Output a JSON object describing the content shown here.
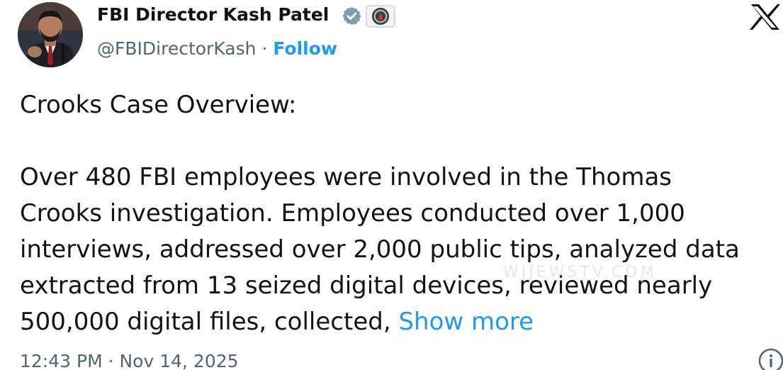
{
  "author": {
    "display_name": "FBI Director Kash Patel",
    "handle": "@FBIDirectorKash",
    "separator": "·",
    "follow_label": "Follow",
    "avatar_icon": "profile-photo",
    "badge_icon": "verified-gray-check-icon",
    "affiliation_icon": "fbi-seal-icon"
  },
  "platform": {
    "logo_icon": "x-logo-icon"
  },
  "tweet": {
    "title": "Crooks Case Overview:",
    "body_lines": [
      "Over 480 FBI employees were involved in the Thomas",
      "Crooks investigation. Employees conducted over 1,000",
      "interviews, addressed over 2,000 public tips, analyzed data",
      "extracted from 13 seized digital devices, reviewed nearly",
      "500,000 digital files, collected, "
    ],
    "show_more_label": "Show more",
    "timestamp": "12:43 PM · Nov 14, 2025",
    "watermark": "WJJEWSTV.COM"
  },
  "colors": {
    "text": "#0f1419",
    "secondary": "#536471",
    "link": "#1d9bf0"
  }
}
